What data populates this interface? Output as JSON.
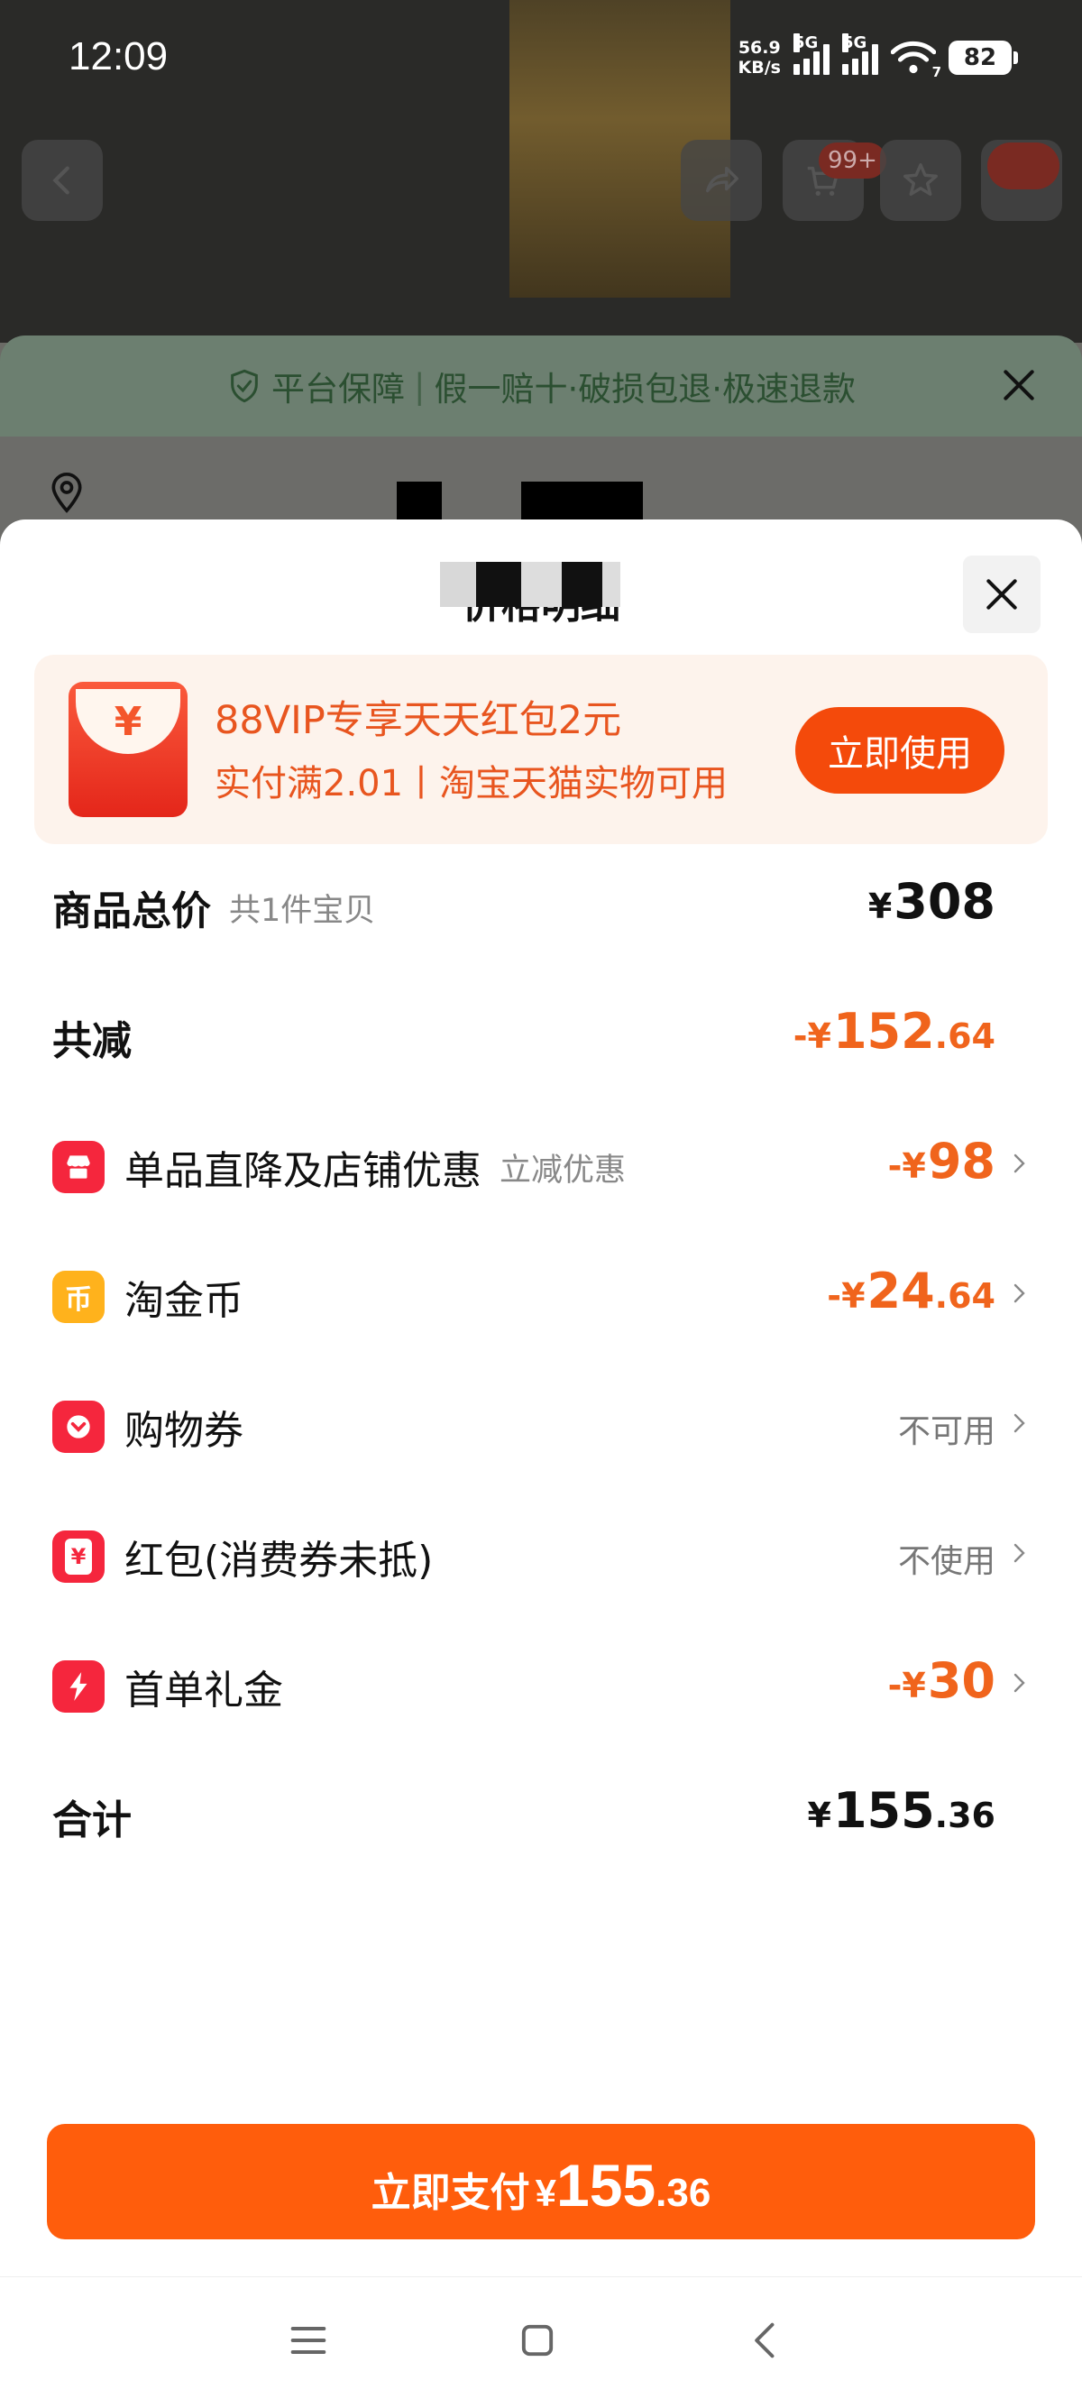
{
  "status_bar": {
    "time": "12:09",
    "speed_value": "56.9",
    "speed_unit": "KB/s",
    "sim1_label": "5G",
    "sim2_label": "5G",
    "wifi_badge": "7",
    "battery": "82"
  },
  "background": {
    "cart_badge": "99+"
  },
  "guarantee": {
    "title": "平台保障",
    "items": "假一赔十·破损包退·极速退款"
  },
  "sheet": {
    "title": "价格明细"
  },
  "promo": {
    "line1": "88VIP专享天天红包2元",
    "line2": "实付满2.01丨淘宝天猫实物可用",
    "button_label": "立即使用",
    "icon_glyph": "¥"
  },
  "rows": {
    "total": {
      "label": "商品总价",
      "sub": "共1件宝贝",
      "currency": "¥",
      "value": "308"
    },
    "reduce": {
      "label": "共减",
      "prefix": "-¥",
      "value_int": "152",
      "value_dec": ".64"
    },
    "shop_discount": {
      "label": "单品直降及店铺优惠",
      "sub": "立减优惠",
      "prefix": "-¥",
      "value_int": "98",
      "icon": "shop-icon"
    },
    "coins": {
      "label": "淘金币",
      "prefix": "-¥",
      "value_int": "24",
      "value_dec": ".64",
      "icon": "coin-icon",
      "icon_glyph": "币"
    },
    "coupon": {
      "label": "购物券",
      "status": "不可用",
      "icon": "coupon-icon"
    },
    "redpacket": {
      "label": "红包(消费券未抵)",
      "status": "不使用",
      "icon": "redpacket-icon",
      "icon_glyph": "¥"
    },
    "first_order": {
      "label": "首单礼金",
      "prefix": "-¥",
      "value_int": "30",
      "icon": "lightning-icon"
    },
    "sum": {
      "label": "合计",
      "currency": "¥",
      "value_int": "155",
      "value_dec": ".36"
    }
  },
  "pay": {
    "label": "立即支付",
    "currency": "¥",
    "value_int": "155",
    "value_dec": ".36"
  },
  "colors": {
    "accent": "#ff5d0c",
    "discount": "#f0641c",
    "promo_bg": "#fdf3ec"
  }
}
